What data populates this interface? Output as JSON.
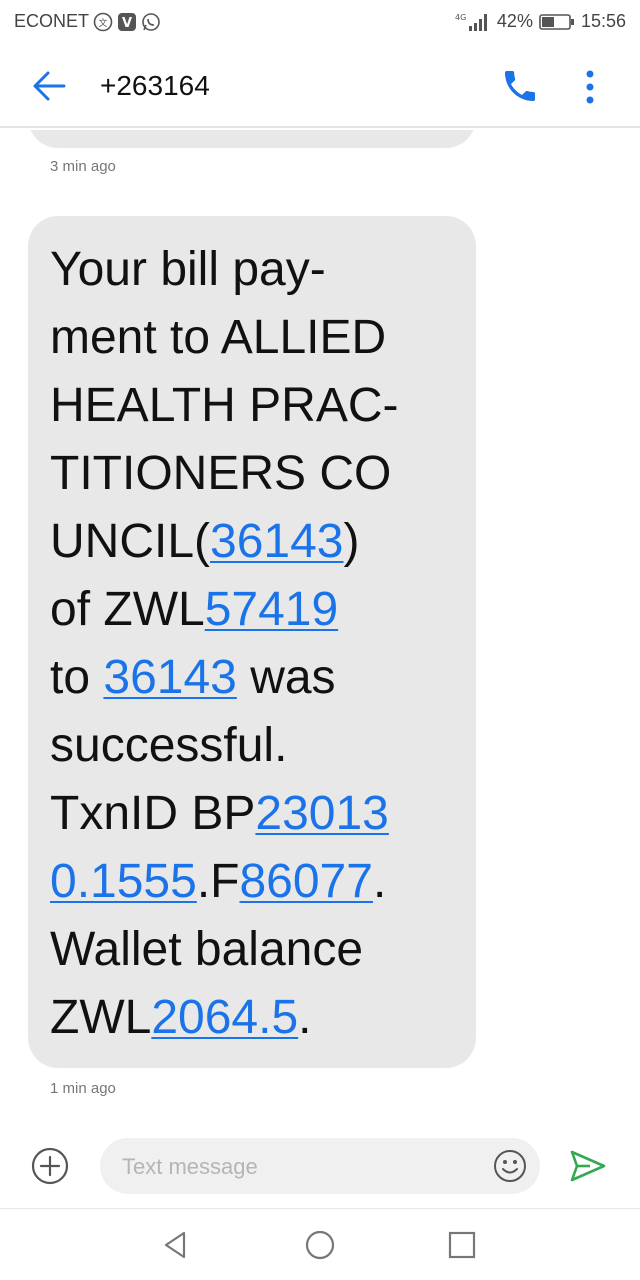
{
  "status_bar": {
    "carrier": "ECONET",
    "network": "4G",
    "battery": "42%",
    "time": "15:56",
    "icons": [
      "translate-icon",
      "viber-icon",
      "whatsapp-icon",
      "signal-icon",
      "battery-icon"
    ]
  },
  "app_bar": {
    "title": "+263164",
    "icons": [
      "back-arrow-icon",
      "phone-icon",
      "more-vertical-icon"
    ]
  },
  "conversation": {
    "previous_message_time": "3 min ago",
    "message": {
      "lines": [
        [
          {
            "t": "Your bill pay-"
          }
        ],
        [
          {
            "t": "ment to ALLIED"
          }
        ],
        [
          {
            "t": "HEALTH PRAC-"
          }
        ],
        [
          {
            "t": "TITIONERS CO"
          }
        ],
        [
          {
            "t": "UNCIL("
          },
          {
            "t": "36143",
            "link": true
          },
          {
            "t": ")"
          }
        ],
        [
          {
            "t": "of ZWL"
          },
          {
            "t": "57419",
            "link": true
          }
        ],
        [
          {
            "t": "to "
          },
          {
            "t": "36143",
            "link": true
          },
          {
            "t": " was"
          }
        ],
        [
          {
            "t": "successful."
          }
        ],
        [
          {
            "t": "TxnID BP"
          },
          {
            "t": "23013",
            "link": true
          }
        ],
        [
          {
            "t": "0.1555",
            "link": true
          },
          {
            "t": ".F"
          },
          {
            "t": "86077",
            "link": true
          },
          {
            "t": "."
          }
        ],
        [
          {
            "t": "Wallet balance"
          }
        ],
        [
          {
            "t": "ZWL"
          },
          {
            "t": "2064.5",
            "link": true
          },
          {
            "t": "."
          }
        ]
      ],
      "time": "1 min ago"
    }
  },
  "composer": {
    "placeholder": "Text message",
    "icons": [
      "add-icon",
      "emoji-icon",
      "send-icon"
    ]
  },
  "nav_bar": {
    "icons": [
      "back-nav-icon",
      "home-nav-icon",
      "recents-nav-icon"
    ]
  },
  "colors": {
    "accent": "#1a73e8",
    "bubble": "#e8e8e8",
    "send": "#34a853"
  }
}
